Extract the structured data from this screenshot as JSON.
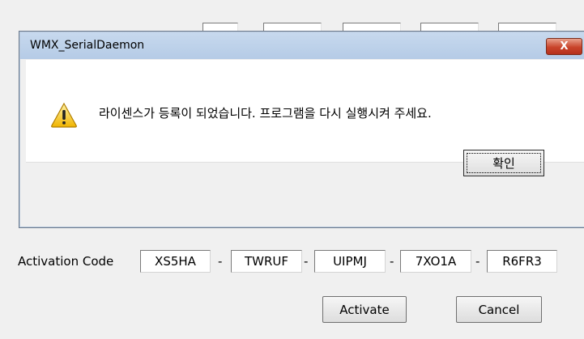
{
  "dialog": {
    "title": "WMX_SerialDaemon",
    "close_glyph": "X",
    "message": "라이센스가 등록이 되었습니다. 프로그램을 다시 실행시켜 주세요.",
    "ok_label": "확인",
    "icon": "warning-icon"
  },
  "form": {
    "activation_label": "Activation Code",
    "code_parts": [
      "XS5HA",
      "TWRUF",
      "UIPMJ",
      "7XO1A",
      "R6FR3"
    ],
    "separator": "-",
    "activate_label": "Activate",
    "cancel_label": "Cancel"
  }
}
